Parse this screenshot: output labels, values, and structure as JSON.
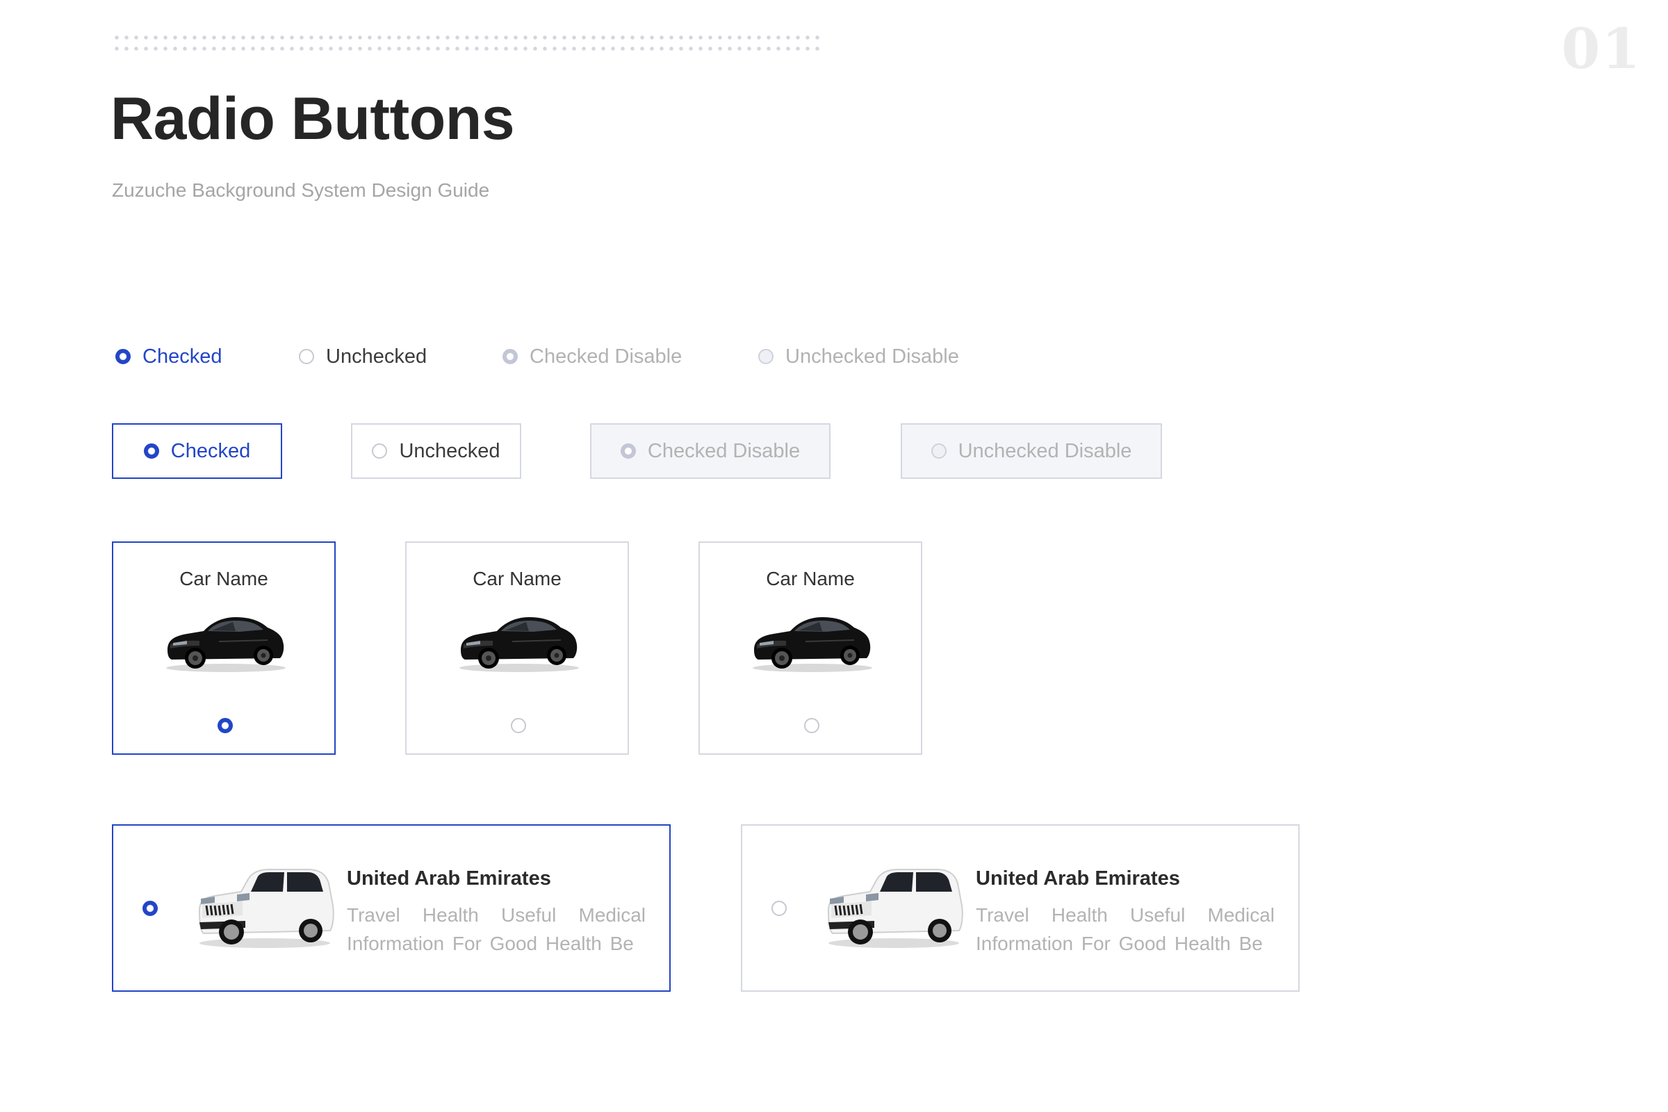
{
  "header": {
    "page_number": "01",
    "title": "Radio Buttons",
    "subtitle": "Zuzuche Background System Design Guide"
  },
  "plain_radios": [
    {
      "label": "Checked",
      "state": "checked"
    },
    {
      "label": "Unchecked",
      "state": "unchecked"
    },
    {
      "label": "Checked Disable",
      "state": "checked-disabled"
    },
    {
      "label": "Unchecked Disable",
      "state": "unchecked-disabled"
    }
  ],
  "boxed_radios": [
    {
      "label": "Checked",
      "state": "checked"
    },
    {
      "label": "Unchecked",
      "state": "unchecked"
    },
    {
      "label": "Checked Disable",
      "state": "checked-disabled"
    },
    {
      "label": "Unchecked Disable",
      "state": "unchecked-disabled"
    }
  ],
  "car_cards": [
    {
      "name": "Car Name",
      "icon": "sedan-car-image",
      "selected": true
    },
    {
      "name": "Car Name",
      "icon": "sedan-car-image",
      "selected": false
    },
    {
      "name": "Car Name",
      "icon": "sedan-car-image",
      "selected": false
    }
  ],
  "list_cards": [
    {
      "title": "United Arab Emirates",
      "description": "Travel Health Useful Medical Information For Good Health Be",
      "icon": "suv-car-image",
      "selected": true
    },
    {
      "title": "United Arab Emirates",
      "description": "Travel Health Useful Medical Information For Good Health Be",
      "icon": "suv-car-image",
      "selected": false
    }
  ],
  "colors": {
    "accent": "#2345c6",
    "border": "#d5d8e0",
    "disabled_bg": "#f4f5f9",
    "muted_text": "#b3b3b3"
  }
}
